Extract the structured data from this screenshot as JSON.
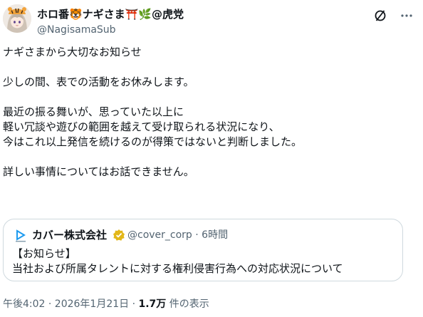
{
  "author": {
    "display_name": "ホロ番🐯ナギさま⛩️🌿@虎党",
    "handle": "@NagisamaSub"
  },
  "header_icons": [
    "grok-icon",
    "more-icon"
  ],
  "tweet": {
    "lines": [
      "ナギさまから大切なお知らせ",
      "",
      "少しの間、表での活動をお休みします。",
      "",
      "最近の振る舞いが、思っていた以上に",
      "軽い冗談や遊びの範囲を越えて受け取られる状況になり、",
      "今はこれ以上発信を続けるのが得策ではないと判断しました。",
      "",
      "詳しい事情についてはお話できません。"
    ]
  },
  "quote": {
    "name": "カバー株式会社",
    "handle_time": "@cover_corp · 6時間",
    "line1": "【お知らせ】",
    "line2": "当社および所属タレントに対する権利侵害行為への対応状況について",
    "badge_color": "#e2b719",
    "logo_color": "#1d9bf0"
  },
  "meta": {
    "timestamp": "午後4:02 · 2026年1月21日 · ",
    "views_count": "1.7万",
    "views_label": " 件の表示"
  }
}
